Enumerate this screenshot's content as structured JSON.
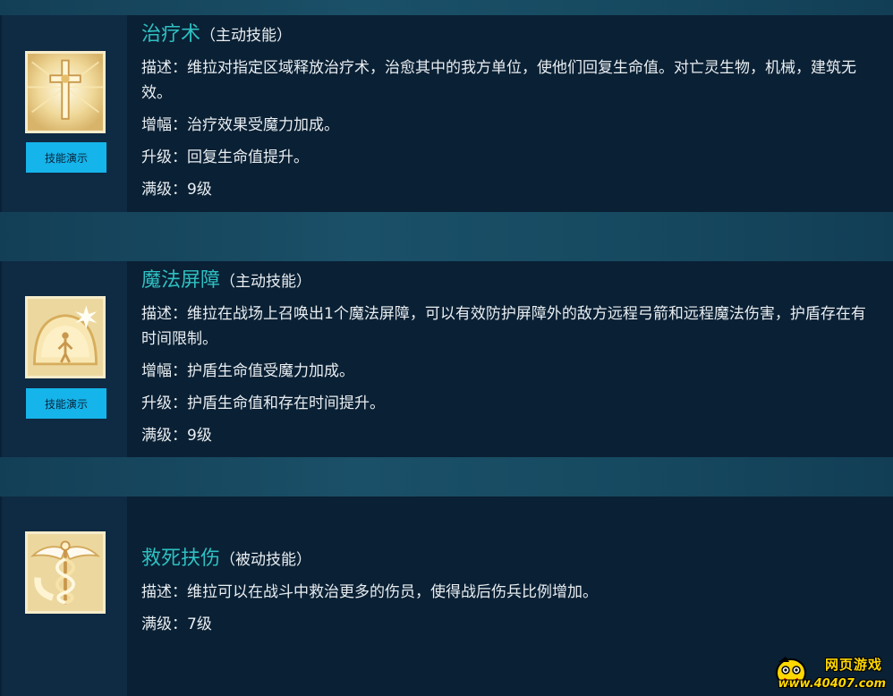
{
  "skills": [
    {
      "name": "治疗术",
      "kind": "（主动技能）",
      "icon": "holy-cross-icon",
      "demo_label": "技能演示",
      "lines": [
        "描述：维拉对指定区域释放治疗术，治愈其中的我方单位，使他们回复生命值。对亡灵生物，机械，建筑无效。",
        "增幅：治疗效果受魔力加成。",
        "升级：回复生命值提升。",
        "满级：9级"
      ]
    },
    {
      "name": "魔法屏障",
      "kind": "（主动技能）",
      "icon": "magic-barrier-icon",
      "demo_label": "技能演示",
      "lines": [
        "描述：维拉在战场上召唤出1个魔法屏障，可以有效防护屏障外的敌方远程弓箭和远程魔法伤害，护盾存在有时间限制。",
        "增幅：护盾生命值受魔力加成。",
        "升级：护盾生命值和存在时间提升。",
        "满级：9级"
      ]
    },
    {
      "name": "救死扶伤",
      "kind": "（被动技能）",
      "icon": "caduceus-icon",
      "lines": [
        "描述：维拉可以在战斗中救治更多的伤员，使得战后伤兵比例增加。",
        "满级：7级"
      ]
    }
  ],
  "watermark": {
    "top_text": "网页游戏",
    "url_text": "www.40407.com"
  }
}
